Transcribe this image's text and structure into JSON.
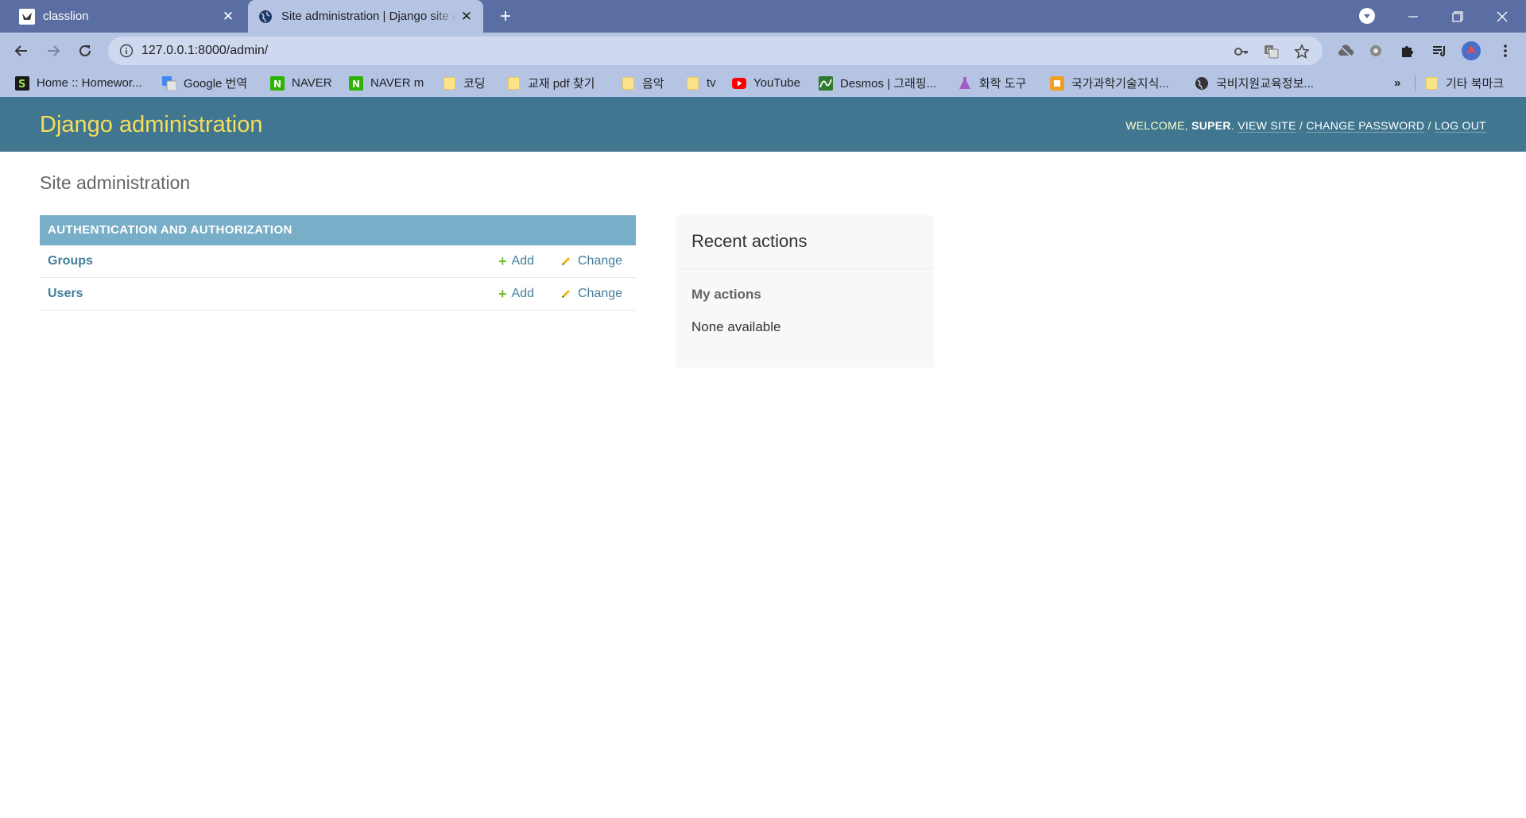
{
  "browser": {
    "tabs": [
      {
        "title": "classlion",
        "favicon": "classlion-icon"
      },
      {
        "title": "Site administration | Django site admin",
        "favicon": "globe-icon"
      }
    ],
    "url": "127.0.0.1:8000/admin/",
    "bookmarks": [
      {
        "label": "Home :: Homewor...",
        "icon": "s-logo-icon"
      },
      {
        "label": "Google 번역",
        "icon": "google-translate-icon"
      },
      {
        "label": "NAVER",
        "icon": "naver-icon"
      },
      {
        "label": "NAVER m",
        "icon": "naver-icon"
      },
      {
        "label": "코딩",
        "icon": "folder-icon"
      },
      {
        "label": "교재 pdf 찾기",
        "icon": "folder-icon"
      },
      {
        "label": "음악",
        "icon": "folder-icon"
      },
      {
        "label": "tv",
        "icon": "folder-icon"
      },
      {
        "label": "YouTube",
        "icon": "youtube-icon"
      },
      {
        "label": "Desmos | 그래핑...",
        "icon": "desmos-icon"
      },
      {
        "label": "화학 도구",
        "icon": "flask-icon"
      },
      {
        "label": "국가과학기술지식...",
        "icon": "ntis-icon"
      },
      {
        "label": "국비지원교육정보...",
        "icon": "globe-icon"
      }
    ],
    "more_bookmarks": "»",
    "other_bookmarks": "기타 북마크"
  },
  "header": {
    "branding": "Django administration",
    "welcome": "WELCOME,",
    "username": "SUPER",
    "view_site": "VIEW SITE",
    "change_password": "CHANGE PASSWORD",
    "logout": "LOG OUT",
    "sep": "/"
  },
  "content": {
    "title": "Site administration",
    "app_caption": "AUTHENTICATION AND AUTHORIZATION",
    "models": [
      {
        "name": "Groups",
        "add": "Add",
        "change": "Change"
      },
      {
        "name": "Users",
        "add": "Add",
        "change": "Change"
      }
    ]
  },
  "recent_actions": {
    "title": "Recent actions",
    "subtitle": "My actions",
    "empty": "None available"
  },
  "colors": {
    "header_bg": "#417690",
    "branding": "#f5dd5d",
    "caption_bg": "#79aec8",
    "link": "#447e9b",
    "add_icon": "#70bf2b",
    "browser_frame": "#5b6ea3",
    "browser_toolbar": "#b6c4e4"
  }
}
